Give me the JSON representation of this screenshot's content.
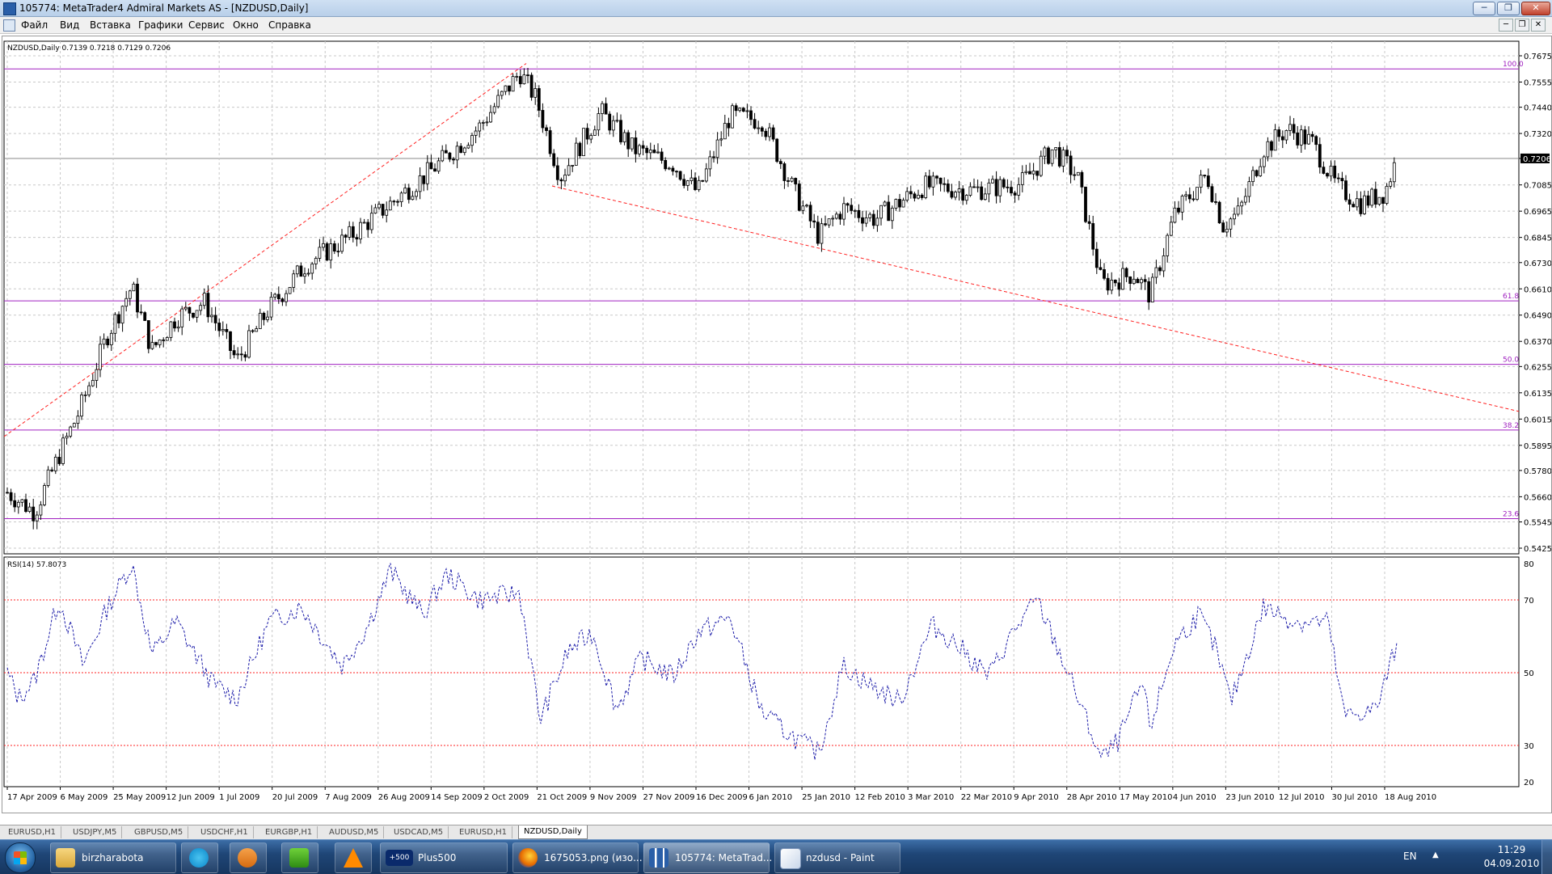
{
  "window": {
    "title": "105774: MetaTrader4 Admiral Markets AS - [NZDUSD,Daily]",
    "min_glyph": "─",
    "max_glyph": "❐",
    "close_glyph": "✕"
  },
  "menu": {
    "items": [
      "Файл",
      "Вид",
      "Вставка",
      "Графики",
      "Сервис",
      "Окно",
      "Справка"
    ],
    "mdi_min": "─",
    "mdi_restore": "❐",
    "mdi_close": "✕"
  },
  "chart": {
    "header": "NZDUSD,Daily  0.7139 0.7218 0.7129 0.7206",
    "price_labels": [
      "0.7675",
      "0.7555",
      "0.7440",
      "0.7320",
      "0.7206",
      "0.7085",
      "0.6965",
      "0.6845",
      "0.6730",
      "0.6610",
      "0.6490",
      "0.6370",
      "0.6255",
      "0.6135",
      "0.6015",
      "0.5895",
      "0.5780",
      "0.5660",
      "0.5545",
      "0.5425"
    ],
    "current_price": "0.7206",
    "fib_labels": [
      "100.0",
      "61.8",
      "50.0",
      "38.2",
      "23.6"
    ],
    "date_labels": [
      "17 Apr 2009",
      "6 May 2009",
      "25 May 2009",
      "12 Jun 2009",
      "1 Jul 2009",
      "20 Jul 2009",
      "7 Aug 2009",
      "26 Aug 2009",
      "14 Sep 2009",
      "2 Oct 2009",
      "21 Oct 2009",
      "9 Nov 2009",
      "27 Nov 2009",
      "16 Dec 2009",
      "6 Jan 2010",
      "25 Jan 2010",
      "12 Feb 2010",
      "3 Mar 2010",
      "22 Mar 2010",
      "9 Apr 2010",
      "28 Apr 2010",
      "17 May 2010",
      "4 Jun 2010",
      "23 Jun 2010",
      "12 Jul 2010",
      "30 Jul 2010",
      "18 Aug 2010"
    ],
    "rsi_header": "RSI(14) 57.8073",
    "rsi_labels": [
      "80",
      "70",
      "50",
      "30",
      "20"
    ]
  },
  "tabs": [
    "EURUSD,H1",
    "USDJPY,M5",
    "GBPUSD,M5",
    "USDCHF,H1",
    "EURGBP,H1",
    "AUDUSD,M5",
    "USDCAD,M5",
    "EURUSD,H1",
    "NZDUSD,Daily"
  ],
  "taskbar": {
    "buttons": [
      "birzharabota",
      "Plus500",
      "1675053.png (изо...",
      "105774: MetaTrad...",
      "nzdusd - Paint"
    ],
    "plus500_badge": "+500",
    "lang": "EN",
    "tray_arrow": "▲",
    "time": "11:29",
    "date": "04.09.2010"
  },
  "colors": {
    "candles": "#000000",
    "fib": "#a020c0",
    "trend": "#ff2020",
    "rsi": "#1a1aa8",
    "rsi_levels": "#ff2020",
    "grid": "#c8c8c8"
  }
}
